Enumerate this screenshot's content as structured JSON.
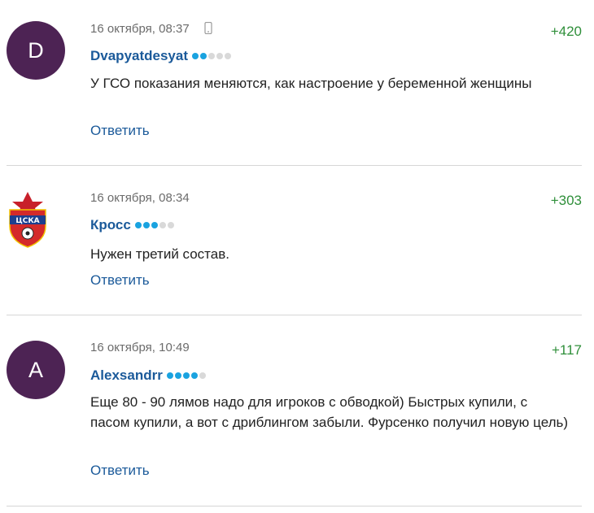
{
  "colors": {
    "avatar_bg": "#4d2354",
    "author": "#1b5a9a",
    "score": "#2f8f3a",
    "reply": "#1b5a9a",
    "rating_on": "#1aa3e0",
    "rating_off": "#d9d9d9"
  },
  "comments": [
    {
      "avatar_letter": "D",
      "timestamp": "16 октября, 08:37",
      "device_icon": "phone-icon",
      "score": "+420",
      "author": "Dvapyatdesyat",
      "rating": {
        "filled": 2,
        "total": 5
      },
      "text": "У ГСО показания меняются, как настроение у беременной женщины",
      "reply_label": "Ответить"
    },
    {
      "avatar_icon": "cska-logo",
      "avatar_logo_text": "ЦСКА",
      "timestamp": "16 октября, 08:34",
      "score": "+303",
      "author": "Кросс",
      "rating": {
        "filled": 3,
        "total": 5
      },
      "text": "Нужен третий состав.",
      "reply_label": "Ответить"
    },
    {
      "avatar_letter": "A",
      "timestamp": "16 октября, 10:49",
      "score": "+117",
      "author": "Alexsandrr",
      "rating": {
        "filled": 4,
        "total": 5
      },
      "text": "Еще 80 - 90 лямов надо для игроков с обводкой) Быстрых купили, с пасом купили, а вот с дриблингом забыли. Фурсенко получил новую цель)",
      "reply_label": "Ответить"
    }
  ]
}
